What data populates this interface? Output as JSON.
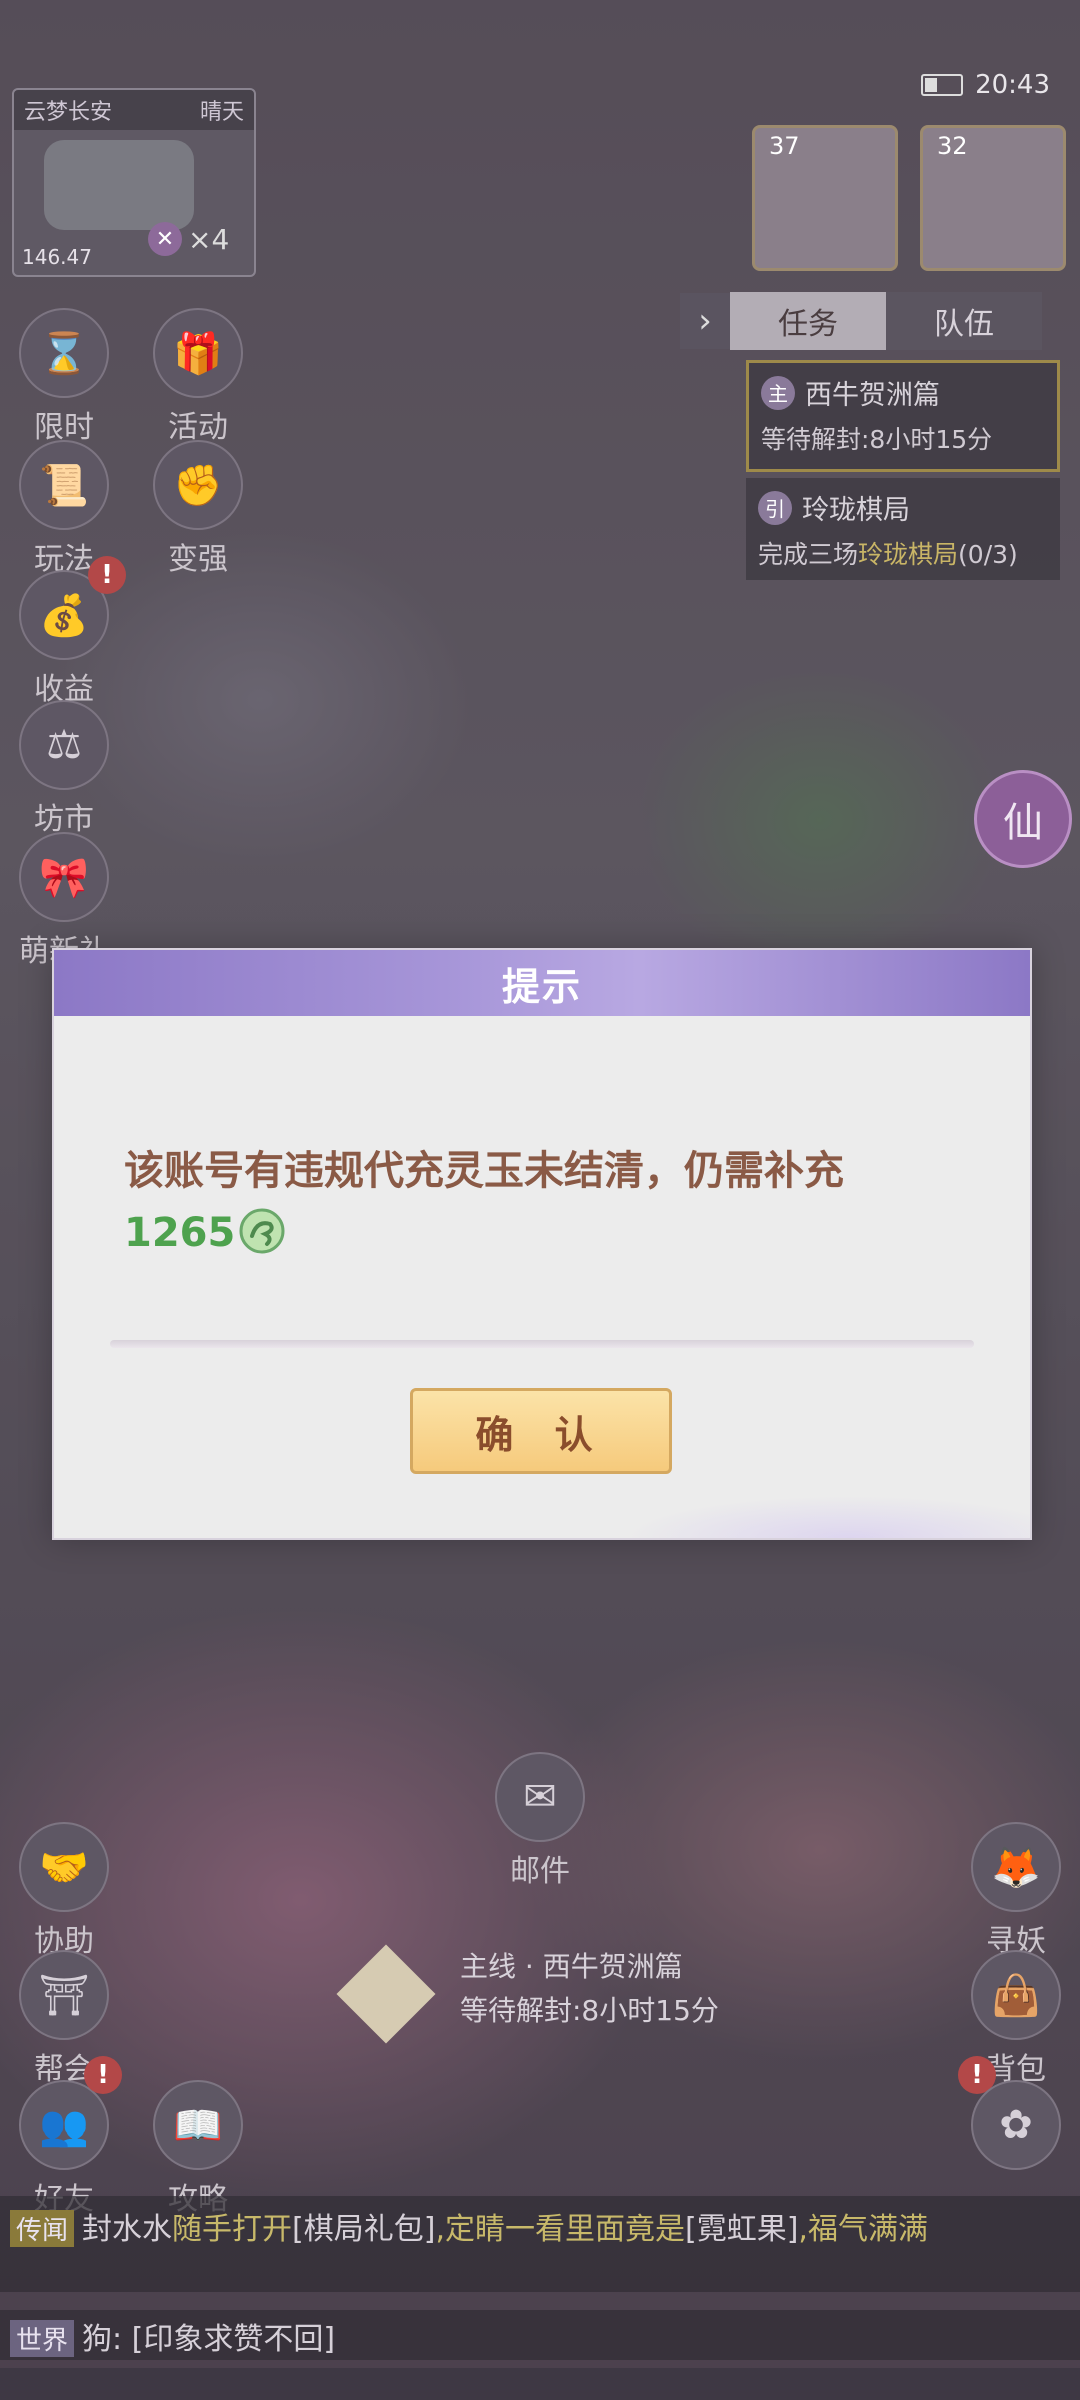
{
  "status": {
    "time": "20:43"
  },
  "minimap": {
    "location": "云梦长安",
    "weather": "晴天",
    "coords": "146.47",
    "team_count": "×4"
  },
  "party": [
    {
      "level": "37"
    },
    {
      "level": "32"
    }
  ],
  "panel": {
    "tabs": [
      "任务",
      "队伍"
    ],
    "quests": [
      {
        "badge": "主",
        "title": "西牛贺洲篇",
        "desc": "等待解封:8小时15分"
      },
      {
        "badge": "引",
        "title": "玲珑棋局",
        "desc_prefix": "完成三场",
        "desc_highlight": "玲珑棋局",
        "desc_suffix": "(0/3)"
      }
    ]
  },
  "left_menu": {
    "limited": "限时",
    "activity": "活动",
    "play": "玩法",
    "stronger": "变强",
    "income": "收益",
    "market": "坊市",
    "newbie_gift": "萌新礼"
  },
  "right_menu": {
    "xian": "仙",
    "search_demon": "寻妖",
    "bag": "背包"
  },
  "bottom_menu": {
    "help": "协助",
    "guild": "帮会",
    "friends": "好友",
    "guide": "攻略",
    "mail": "邮件"
  },
  "badges": {
    "alert": "!"
  },
  "main_task": {
    "title": "主线 · 西牛贺洲篇",
    "status": "等待解封:8小时15分"
  },
  "chat": [
    {
      "channel": "传闻",
      "speaker": "封水水",
      "text_before": "随手打开",
      "item1": "[棋局礼包]",
      "text_mid": ",定睛一看里面竟是",
      "item2": "[霓虹果]",
      "text_after": ",福气满满"
    },
    {
      "channel": "世界",
      "speaker": "狗:",
      "text": "[印象求赞不回]"
    }
  ],
  "dialog": {
    "title": "提示",
    "message": "该账号有违规代充灵玉未结清，仍需补充",
    "amount": "1265",
    "currency_icon": "jade-icon",
    "confirm": "确 认"
  },
  "colors": {
    "accent_purple": "#8c78c6",
    "amount_green": "#4ea24e",
    "message_brown": "#8a5a46",
    "button_gold": "#f6ca7c"
  }
}
